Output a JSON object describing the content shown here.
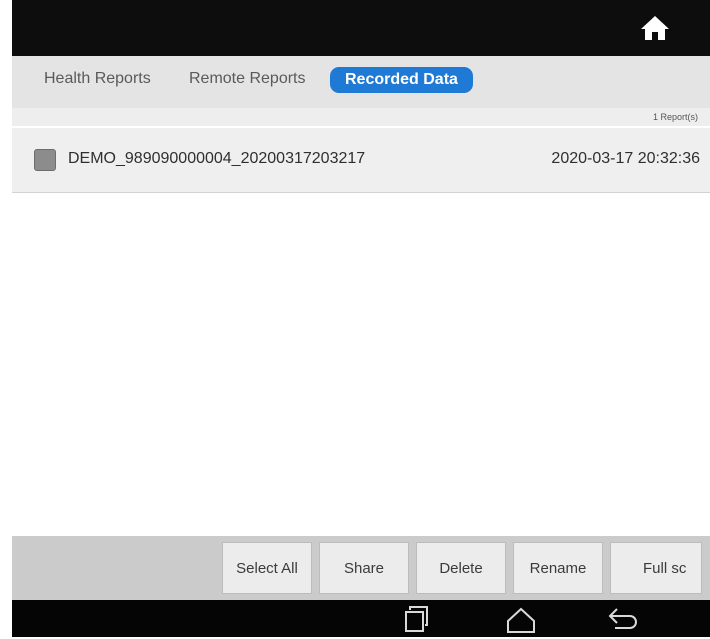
{
  "header": {
    "home_icon": "home-icon"
  },
  "tabs": [
    {
      "label": "Health Reports",
      "active": false
    },
    {
      "label": "Remote Reports",
      "active": false
    },
    {
      "label": "Recorded Data",
      "active": true
    }
  ],
  "list": {
    "count_text": "1 Report(s)",
    "items": [
      {
        "name": "DEMO_989090000004_20200317203217",
        "date": "2020-03-17 20:32:36",
        "checked": false
      }
    ]
  },
  "toolbar": {
    "select_all": "Select All",
    "share": "Share",
    "delete": "Delete",
    "rename": "Rename",
    "full_screen": "Full sc"
  },
  "navbar": {
    "recent_icon": "recent-apps-icon",
    "home_icon": "android-home-icon",
    "back_icon": "back-icon"
  },
  "colors": {
    "accent": "#1e7ad4",
    "topbar": "#0d0d0d",
    "tabbar": "#e4e4e4",
    "bottombar": "#cbcbcb"
  }
}
